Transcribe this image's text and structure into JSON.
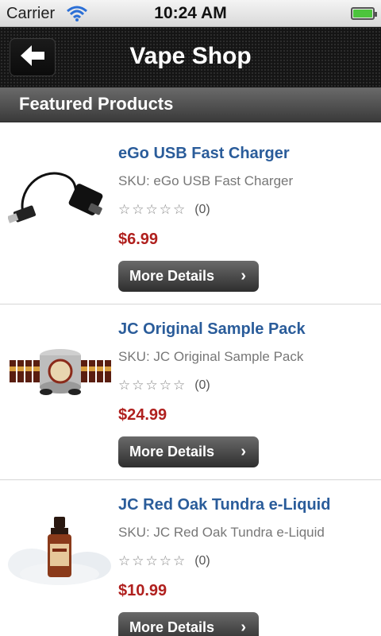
{
  "status_bar": {
    "carrier": "Carrier",
    "time": "10:24 AM"
  },
  "nav": {
    "title": "Vape Shop",
    "back_icon": "back-arrow-icon"
  },
  "section": {
    "title": "Featured Products"
  },
  "products": [
    {
      "name": "eGo USB Fast Charger",
      "sku": "SKU: eGo USB Fast Charger",
      "rating_count": "(0)",
      "price": "$6.99",
      "button_label": "More Details",
      "image_icon": "usb-charger-image"
    },
    {
      "name": "JC Original Sample Pack",
      "sku": "SKU: JC Original Sample Pack",
      "rating_count": "(0)",
      "price": "$24.99",
      "button_label": "More Details",
      "image_icon": "sample-pack-image"
    },
    {
      "name": "JC Red Oak Tundra e-Liquid",
      "sku": "SKU: JC Red Oak Tundra e-Liquid",
      "rating_count": "(0)",
      "price": "$10.99",
      "button_label": "More Details",
      "image_icon": "eliquid-bottle-image"
    }
  ],
  "colors": {
    "product_name": "#2a5c9a",
    "price": "#b0201e",
    "battery": "#4cc43c"
  }
}
